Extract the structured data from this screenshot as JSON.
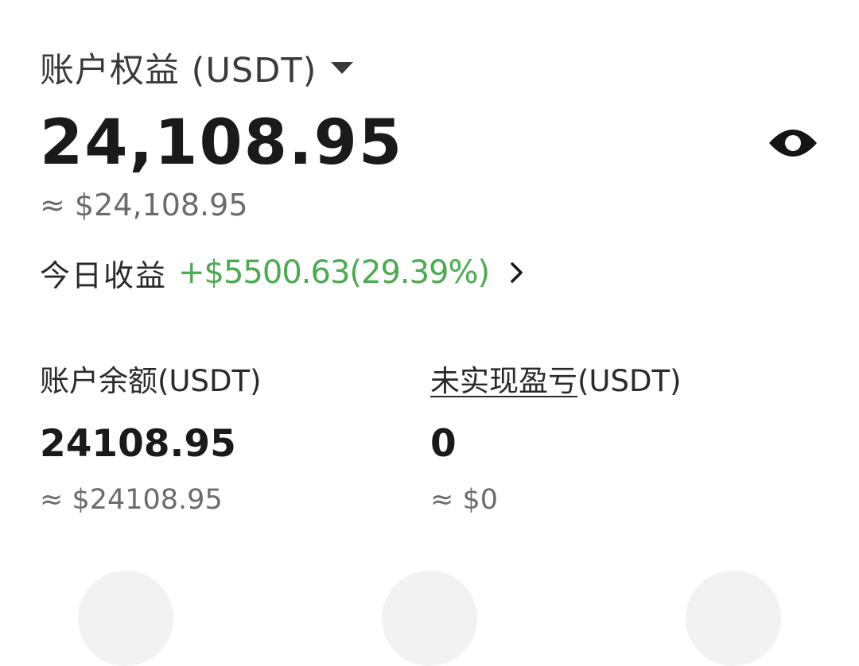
{
  "equity": {
    "label": "账户权益 (USDT)",
    "value": "24,108.95",
    "approx": "≈ $24,108.95"
  },
  "today_pnl": {
    "label": "今日收益",
    "value": "+$5500.63(29.39%)"
  },
  "balance": {
    "label": "账户余额(USDT)",
    "value": "24108.95",
    "approx": "≈ $24108.95"
  },
  "unrealized_pnl": {
    "label_underlined": "未实现盈亏",
    "label_suffix": "(USDT)",
    "value": "0",
    "approx": "≈ $0"
  },
  "colors": {
    "positive": "#4caa52",
    "primary_text": "#1a1a1a",
    "secondary_text": "#6b6b6b"
  },
  "icons": {
    "currency_dropdown": "caret-down-icon",
    "visibility": "eye-icon",
    "details": "chevron-right-icon"
  }
}
